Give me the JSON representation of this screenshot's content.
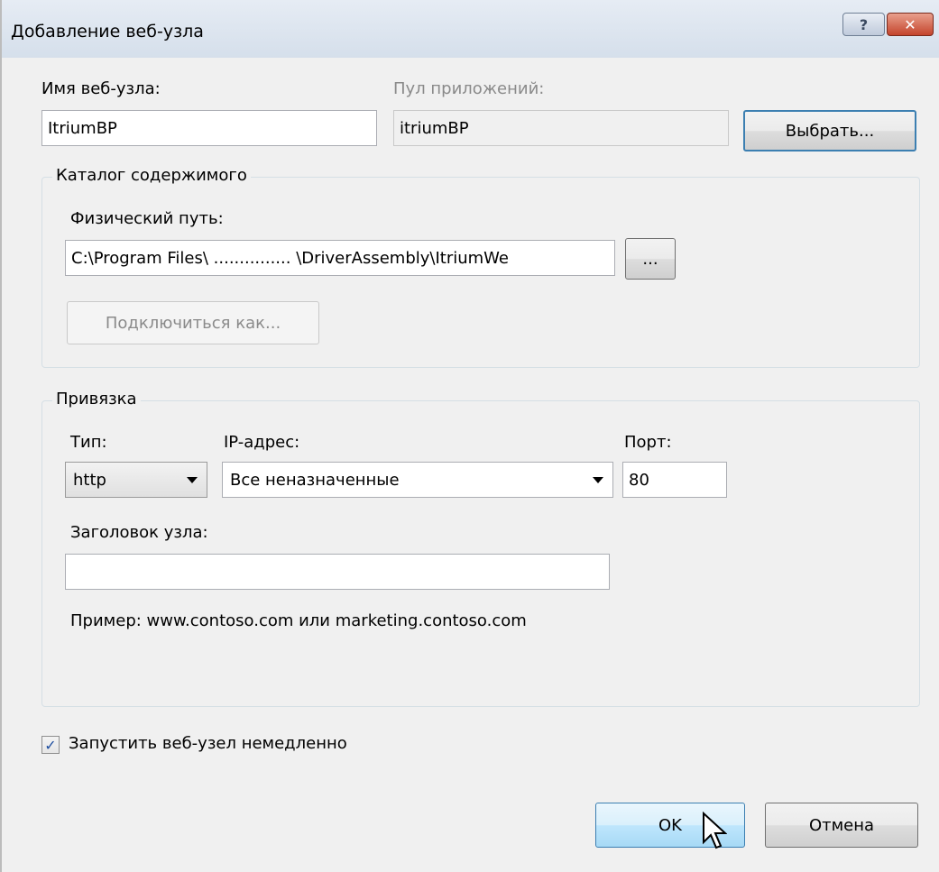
{
  "window": {
    "title": "Добавление веб-узла",
    "help_symbol": "?",
    "close_symbol": "✕"
  },
  "site": {
    "name_label": "Имя веб-узла:",
    "name_value": "ItriumBP",
    "pool_label": "Пул приложений:",
    "pool_value": "itriumBP",
    "select_button": "Выбрать..."
  },
  "content_dir": {
    "group_title": "Каталог содержимого",
    "path_label": "Физический путь:",
    "path_value": "C:\\Program Files\\   ............... \\DriverAssembly\\ItriumWe",
    "browse_button": "...",
    "connect_as_button": "Подключиться как..."
  },
  "binding": {
    "group_title": "Привязка",
    "type_label": "Тип:",
    "type_value": "http",
    "ip_label": "IP-адрес:",
    "ip_value": "Все неназначенные",
    "port_label": "Порт:",
    "port_value": "80",
    "host_label": "Заголовок узла:",
    "host_value": "",
    "example_text": "Пример: www.contoso.com или marketing.contoso.com"
  },
  "start_immediately": {
    "label": "Запустить веб-узел немедленно",
    "checked": true,
    "check_mark": "✓"
  },
  "footer": {
    "ok_button": "OK",
    "cancel_button": "Отмена"
  },
  "icons": {
    "cursor": "mouse-pointer-icon"
  }
}
